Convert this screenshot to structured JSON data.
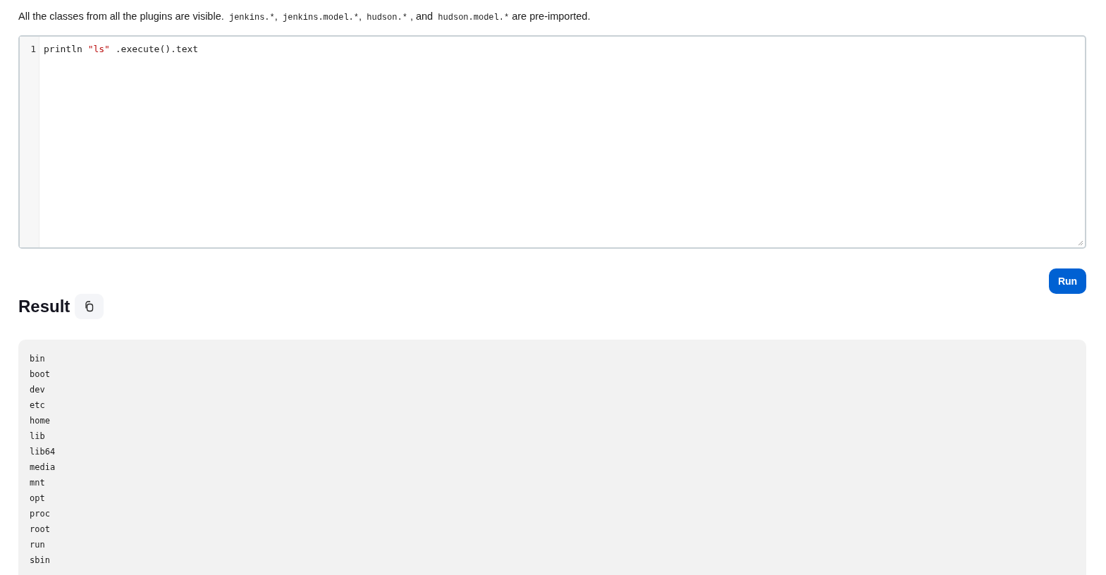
{
  "description": [
    {
      "kind": "text",
      "text": "All the classes from all the plugins are visible."
    },
    {
      "kind": "code",
      "text": "jenkins.*"
    },
    {
      "kind": "text",
      "text": ","
    },
    {
      "kind": "code",
      "text": "jenkins.model.*"
    },
    {
      "kind": "text",
      "text": ","
    },
    {
      "kind": "code",
      "text": "hudson.*"
    },
    {
      "kind": "text",
      "text": ", and"
    },
    {
      "kind": "code",
      "text": "hudson.model.*"
    },
    {
      "kind": "text",
      "text": "are pre-imported."
    }
  ],
  "editor": {
    "lines": [
      {
        "number": "1",
        "tokens": [
          {
            "kind": "plain",
            "text": "println "
          },
          {
            "kind": "string",
            "text": "\"ls\""
          },
          {
            "kind": "plain",
            "text": " .execute().text"
          }
        ]
      }
    ]
  },
  "run_button": "Run",
  "result": {
    "title": "Result",
    "lines": [
      "bin",
      "boot",
      "dev",
      "etc",
      "home",
      "lib",
      "lib64",
      "media",
      "mnt",
      "opt",
      "proc",
      "root",
      "run",
      "sbin"
    ]
  }
}
